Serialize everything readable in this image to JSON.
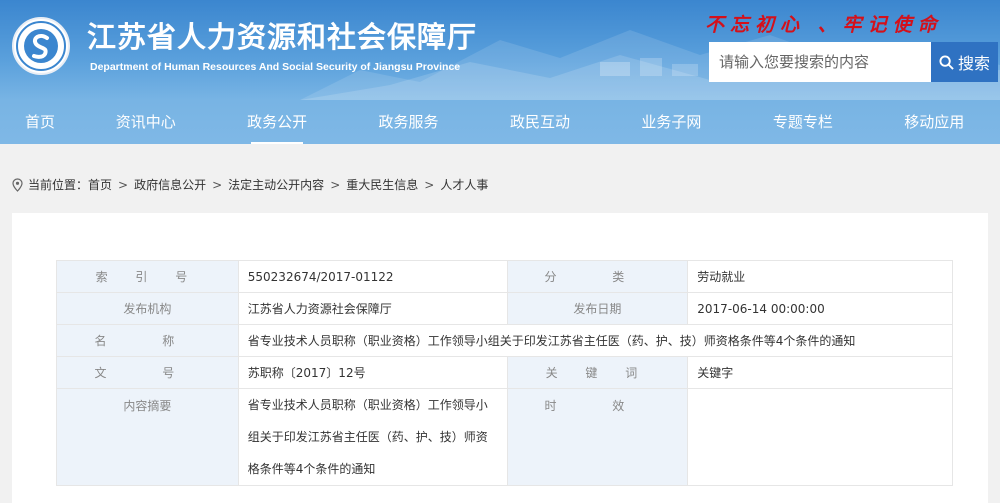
{
  "header": {
    "title": "江苏省人力资源和社会保障厅",
    "subtitle": "Department of Human Resources And Social Security of Jiangsu Province",
    "slogan": "不忘初心 、牢记使命",
    "search_placeholder": "请输入您要搜索的内容",
    "search_label": "搜索"
  },
  "nav": {
    "items": [
      {
        "label": "首页"
      },
      {
        "label": "资讯中心"
      },
      {
        "label": "政务公开"
      },
      {
        "label": "政务服务"
      },
      {
        "label": "政民互动"
      },
      {
        "label": "业务子网"
      },
      {
        "label": "专题专栏"
      },
      {
        "label": "移动应用"
      }
    ],
    "active": "政务公开"
  },
  "breadcrumb": {
    "prefix": "当前位置：",
    "items": [
      "首页",
      "政府信息公开",
      "法定主动公开内容",
      "重大民生信息",
      "人才人事"
    ]
  },
  "info": {
    "index_label": "索 引 号",
    "index_value": "550232674/2017-01122",
    "category_label": "分 类",
    "category_value": "劳动就业",
    "publisher_label": "发布机构",
    "publisher_value": "江苏省人力资源社会保障厅",
    "date_label": "发布日期",
    "date_value": "2017-06-14 00:00:00",
    "name_label": "名 称",
    "name_value": "省专业技术人员职称（职业资格）工作领导小组关于印发江苏省主任医（药、护、技）师资格条件等4个条件的通知",
    "docno_label": "文 号",
    "docno_value": "苏职称〔2017〕12号",
    "keyword_label": "关 键 词",
    "keyword_value": "关键字",
    "abstract_label": "内容摘要",
    "abstract_value": "省专业技术人员职称（职业资格）工作领导小组关于印发江苏省主任医（药、护、技）师资格条件等4个条件的通知",
    "validity_label": "时 效",
    "validity_value": ""
  },
  "colors": {
    "header_blue": "#3b86cf",
    "nav_blue": "#7fb8e6",
    "search_button": "#2f72c2",
    "slogan_red": "#d4101a",
    "label_cell_bg": "#edf3fa"
  }
}
